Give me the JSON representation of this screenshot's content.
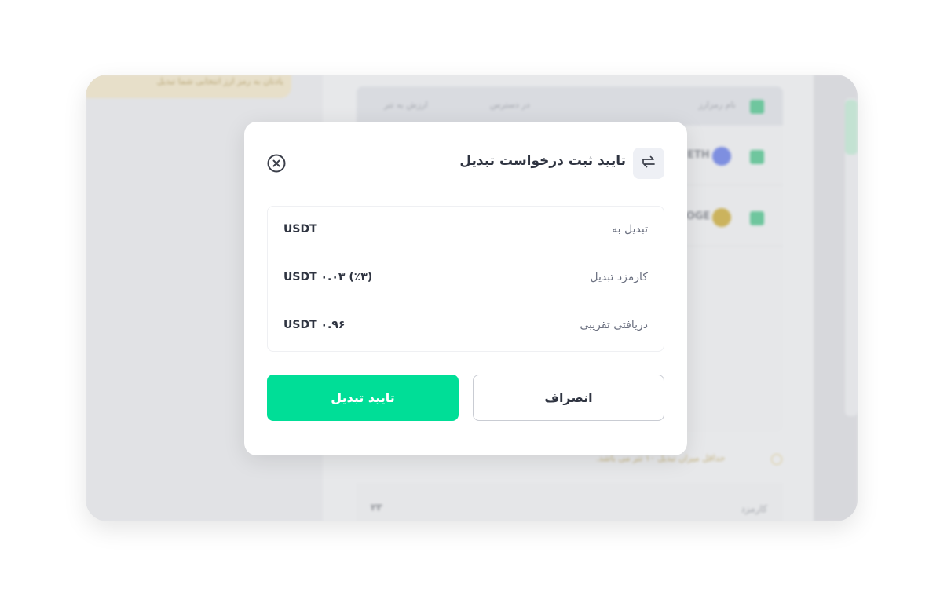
{
  "background": {
    "banner_text": "یادتان به رمز ارز انتخابی شما تبدیل",
    "table_headers": [
      "نام رمزارز",
      "در دسترس",
      "ارزش به تتر"
    ],
    "coins": [
      {
        "symbol": "ETH",
        "color": "#7e8fe0"
      },
      {
        "symbol": "DOGE",
        "color": "#cbb35d"
      }
    ],
    "note_text": "حداقل میزان تبدیل ۱۰ تتر می باشد.",
    "bottom_label": "کارمزد",
    "bottom_value": "۲۳"
  },
  "modal": {
    "title": "تایید ثبت درخواست تبدیل",
    "rows": [
      {
        "label": "تبدیل به",
        "value": "USDT"
      },
      {
        "label": "کارمزد تبدیل",
        "value": "USDT ۰.۰۳ (٪۳)"
      },
      {
        "label": "دریافتی تقریبی",
        "value": "USDT ۰.۹۶"
      }
    ],
    "confirm_label": "تایید تبدیل",
    "cancel_label": "انصراف"
  },
  "colors": {
    "accent": "#00de97",
    "title": "#2f3441",
    "label": "#6b7080"
  },
  "icons": {
    "close": "close-circle-icon",
    "header": "swap-arrows-icon"
  }
}
